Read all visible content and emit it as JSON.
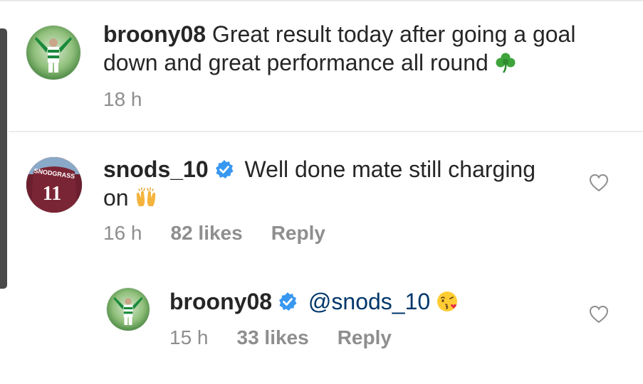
{
  "comments": [
    {
      "username": "broony08",
      "text": "Great result today after going a goal",
      "text_line2": "down and great performance all round",
      "emoji": "shamrock-icon",
      "time": "18 h"
    },
    {
      "username": "snods_10",
      "verified": true,
      "text": "Well done mate still charging",
      "text_line2": "on",
      "emoji": "raised-hands-icon",
      "time": "16 h",
      "likes": "82 likes",
      "reply_label": "Reply",
      "avatar_shirt_name": "SNODGRASS",
      "avatar_shirt_number": "11",
      "replies": [
        {
          "username": "broony08",
          "verified": true,
          "mention": "@snods_10",
          "emoji": "kissing-face-icon",
          "time": "15 h",
          "likes": "33 likes",
          "reply_label": "Reply"
        }
      ]
    }
  ],
  "colors": {
    "text": "#262626",
    "meta": "#8e8e8e",
    "verified": "#3897f0",
    "mention": "#00376b"
  }
}
